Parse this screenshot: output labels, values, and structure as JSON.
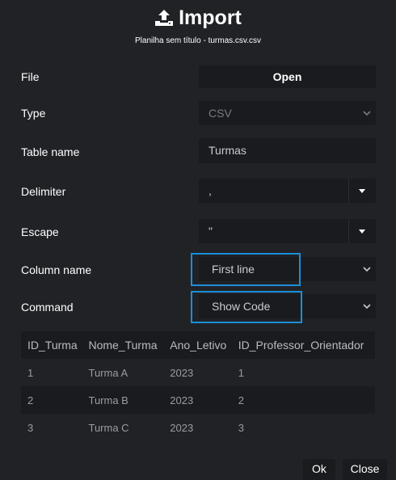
{
  "dialog": {
    "title": "Import",
    "subtitle": "Planilha sem título - turmas.csv.csv"
  },
  "form": {
    "file": {
      "label": "File",
      "button": "Open"
    },
    "type": {
      "label": "Type",
      "value": "CSV"
    },
    "table_name": {
      "label": "Table name",
      "value": "Turmas"
    },
    "delimiter": {
      "label": "Delimiter",
      "value": ","
    },
    "escape": {
      "label": "Escape",
      "value": "\""
    },
    "column_name": {
      "label": "Column name",
      "value": "First line"
    },
    "command": {
      "label": "Command",
      "value": "Show Code"
    }
  },
  "preview": {
    "columns": [
      "ID_Turma",
      "Nome_Turma",
      "Ano_Letivo",
      "ID_Professor_Orientador"
    ],
    "rows": [
      [
        "1",
        "Turma A",
        "2023",
        "1"
      ],
      [
        "2",
        "Turma B",
        "2023",
        "2"
      ],
      [
        "3",
        "Turma C",
        "2023",
        "3"
      ]
    ]
  },
  "footer": {
    "ok": "Ok",
    "close": "Close"
  },
  "colors": {
    "accent_highlight": "#1a8fd8",
    "background": "#212226",
    "control": "#1a1b1e"
  },
  "icons": {
    "title": "upload-icon"
  }
}
